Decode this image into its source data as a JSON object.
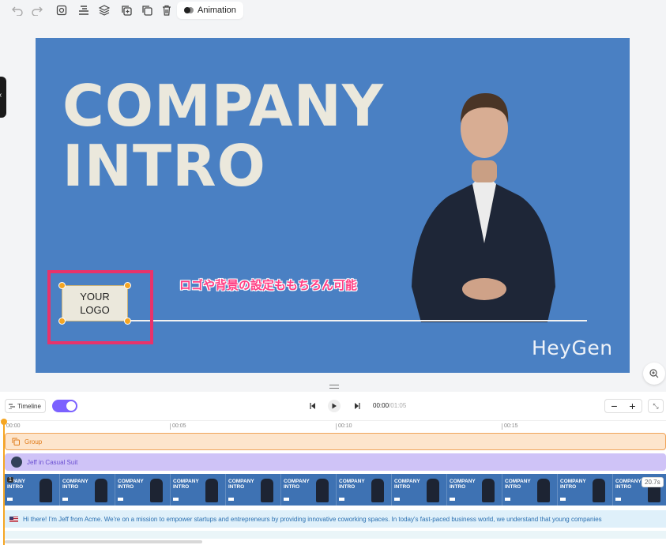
{
  "toolbar": {
    "icons": [
      "undo-icon",
      "redo-icon",
      "replace-media-icon",
      "align-icon",
      "layers-icon",
      "duplicate-icon",
      "copy-icon",
      "delete-icon"
    ],
    "animation_label": "Animation"
  },
  "canvas": {
    "title_line1": "COMPANY",
    "title_line2": "INTRO",
    "logo_line1": "YOUR",
    "logo_line2": "LOGO",
    "callout": "ロゴや背景の設定ももちろん可能",
    "brand": "HeyGen",
    "background_color": "#4a80c3",
    "highlight_color": "#e8336b"
  },
  "timeline": {
    "timeline_label": "Timeline",
    "current_time": "00:00",
    "total_time": "/01:05",
    "ruler_ticks": [
      "00:00",
      "00:05",
      "00:10",
      "00:15"
    ],
    "group_label": "Group",
    "avatar_label": "Jeff in Casual Suit",
    "scene_index": "1",
    "scene_duration": "20.7s",
    "frame_title_line1": "COMPANY",
    "frame_title_line2": "INTRO",
    "frame_first_line1": "MPANY",
    "frame_count": 12,
    "script_text": "Hi there! I'm Jeff from Acme. We're on a mission to empower startups and entrepreneurs by providing innovative coworking spaces. In today's fast-paced business world, we understand that young companies"
  }
}
